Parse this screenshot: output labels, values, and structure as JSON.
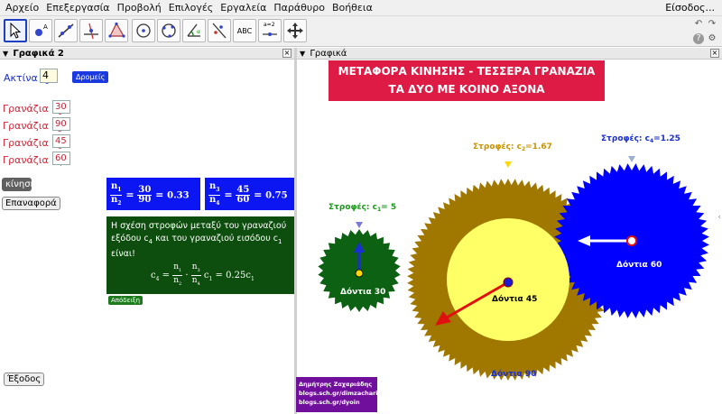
{
  "menu": [
    "Αρχείο",
    "Επεξεργασία",
    "Προβολή",
    "Επιλογές",
    "Εργαλεία",
    "Παράθυρο",
    "Βοήθεια"
  ],
  "signin": "Είσοδος...",
  "toolbar": {
    "text_tool": "ABC",
    "slider_tool": "a=2"
  },
  "left_panel": {
    "title": "Γραφικά 2",
    "radius_label": "Ακτίνα r",
    "radius_sub": "1",
    "radius_value": "4",
    "paths_button": "Δρομείς",
    "gear_label": "Γρανάζια n",
    "gears": [
      {
        "sub": "1",
        "value": "30"
      },
      {
        "sub": "2",
        "value": "90"
      },
      {
        "sub": "3",
        "value": "45"
      },
      {
        "sub": "4",
        "value": "60"
      }
    ],
    "motion_button": "κίνηση",
    "reset_button": "Επαναφορά",
    "exit_button": "Έξοδος",
    "ratio1": {
      "num_l": "n",
      "num_l_sub": "1",
      "den_l": "n",
      "den_l_sub": "2",
      "num": "30",
      "den": "90",
      "result": "0.33"
    },
    "ratio2": {
      "num_l": "n",
      "num_l_sub": "3",
      "den_l": "n",
      "den_l_sub": "4",
      "num": "45",
      "den": "60",
      "result": "0.75"
    },
    "relation_text_1": "Η σχέση στροφών μεταξύ του γραναζιού",
    "relation_text_2a": "εξόδου c",
    "relation_text_2b": " και του γραναζιού εισόδου c",
    "relation_text_3": "είναι!",
    "relation_result": "0.25c",
    "proof_button": "Απόδειξη"
  },
  "graphics": {
    "title": "Γραφικά",
    "banner_line1": "ΜΕΤΑΦΟΡΑ ΚΙΝΗΣΗΣ - ΤΕΣΣΕΡΑ ΓΡΑΝΑΖΙΑ",
    "banner_line2": "ΤΑ ΔΥΟ ΜΕ ΚΟΙΝΟ ΑΞΟΝΑ",
    "rot_label": "Στροφές: c",
    "c1_sub": "1",
    "c1_val": "= 5",
    "c2_sub": "2",
    "c2_val": "=1.67",
    "c4_sub": "4",
    "c4_val": "=1.25",
    "teeth_30": "Δόντια 30",
    "teeth_45": "Δόντια 45",
    "teeth_60": "Δόντια 60",
    "teeth_90": "Δόντια 90",
    "credit_name": "Δημήτρης Ζαχαριάδης",
    "credit_url1": "blogs.sch.gr/dimzachari",
    "credit_url2": "blogs.sch.gr/dyoin"
  },
  "colors": {
    "gear30": "#0c6112",
    "gear90": "#a07800",
    "gear45": "#ffff66",
    "gear60": "#0000ff",
    "banner": "#dd1b45",
    "formula": "#0b16f2"
  }
}
